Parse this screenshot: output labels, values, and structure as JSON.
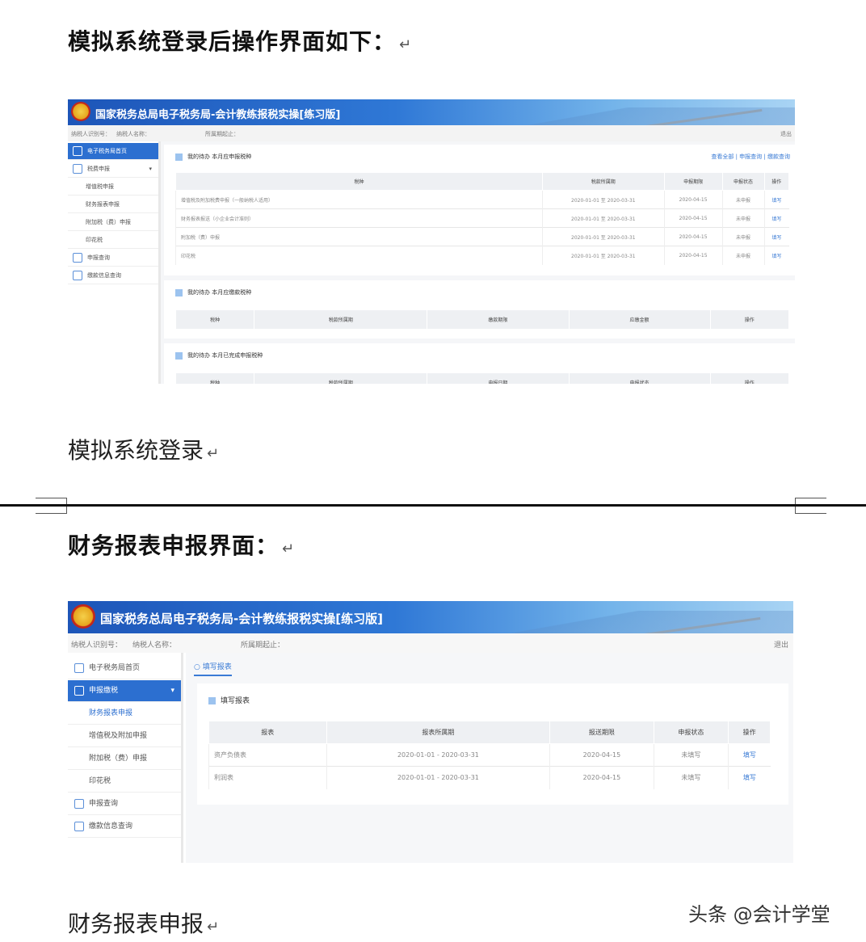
{
  "doc": {
    "heading1": "模拟系统登录后操作界面如下：",
    "caption1": "模拟系统登录",
    "heading2": "财务报表申报界面：",
    "caption2": "财务报表申报",
    "return_mark": "↵",
    "watermark": "头条 @会计学堂"
  },
  "shot1": {
    "banner_title": "国家税务总局电子税务局-会计教练报税实操[练习版]",
    "info": [
      "纳税人识别号：",
      "纳税人名称：",
      "所属期起止：",
      "退出"
    ],
    "nav": [
      {
        "label": "电子税务局首页",
        "active": true
      },
      {
        "label": "税费申报",
        "active": false
      },
      {
        "label": "增值税申报",
        "active": false
      },
      {
        "label": "财务报表申报",
        "active": false
      },
      {
        "label": "附加税（费）申报",
        "active": false
      },
      {
        "label": "印花税",
        "active": false
      },
      {
        "label": "申报查询",
        "active": false
      },
      {
        "label": "缴款信息查询",
        "active": false
      }
    ],
    "panel1": {
      "title": "我的待办 本月应申报税种",
      "links": "查看全部 | 申报查询 | 缴款查询",
      "headers": [
        "税种",
        "税款所属期",
        "申报期限",
        "申报状态",
        "操作"
      ],
      "rows": [
        [
          "增值税及附加税费申报（一般纳税人适用）",
          "2020-01-01 至 2020-03-31",
          "2020-04-15",
          "未申报",
          "填写"
        ],
        [
          "财务报表报送（小企业会计准则）",
          "2020-01-01 至 2020-03-31",
          "2020-04-15",
          "未申报",
          "填写"
        ],
        [
          "附加税（费）申报",
          "2020-01-01 至 2020-03-31",
          "2020-04-15",
          "未申报",
          "填写"
        ],
        [
          "印花税",
          "2020-01-01 至 2020-03-31",
          "2020-04-15",
          "未申报",
          "填写"
        ]
      ]
    },
    "panel2": {
      "title": "我的待办 本月应缴款税种",
      "headers": [
        "税种",
        "税款所属期",
        "缴款期限",
        "应缴金额",
        "操作"
      ]
    },
    "panel3": {
      "title": "我的待办 本月已完成申报税种",
      "headers": [
        "税种",
        "税款所属期",
        "申报日期",
        "申报状态",
        "操作"
      ]
    }
  },
  "shot2": {
    "banner_title": "国家税务总局电子税务局-会计教练报税实操[练习版]",
    "info": [
      "纳税人识别号：",
      "纳税人名称：",
      "所属期起止：",
      "退出"
    ],
    "nav": [
      {
        "label": "电子税务局首页",
        "active": false
      },
      {
        "label": "申报缴税",
        "active": true
      },
      {
        "label": "财务报表申报",
        "active": false
      },
      {
        "label": "增值税及附加申报",
        "active": false
      },
      {
        "label": "附加税（费）申报",
        "active": false
      },
      {
        "label": "印花税",
        "active": false
      },
      {
        "label": "申报查询",
        "active": false
      },
      {
        "label": "缴款信息查询",
        "active": false
      }
    ],
    "tab": "填写报表",
    "panel_title": "填写报表",
    "headers": [
      "报表",
      "报表所属期",
      "报送期限",
      "申报状态",
      "操作"
    ],
    "rows": [
      [
        "资产负债表",
        "2020-01-01 - 2020-03-31",
        "2020-04-15",
        "未填写",
        "填写"
      ],
      [
        "利润表",
        "2020-01-01 - 2020-03-31",
        "2020-04-15",
        "未填写",
        "填写"
      ]
    ]
  }
}
